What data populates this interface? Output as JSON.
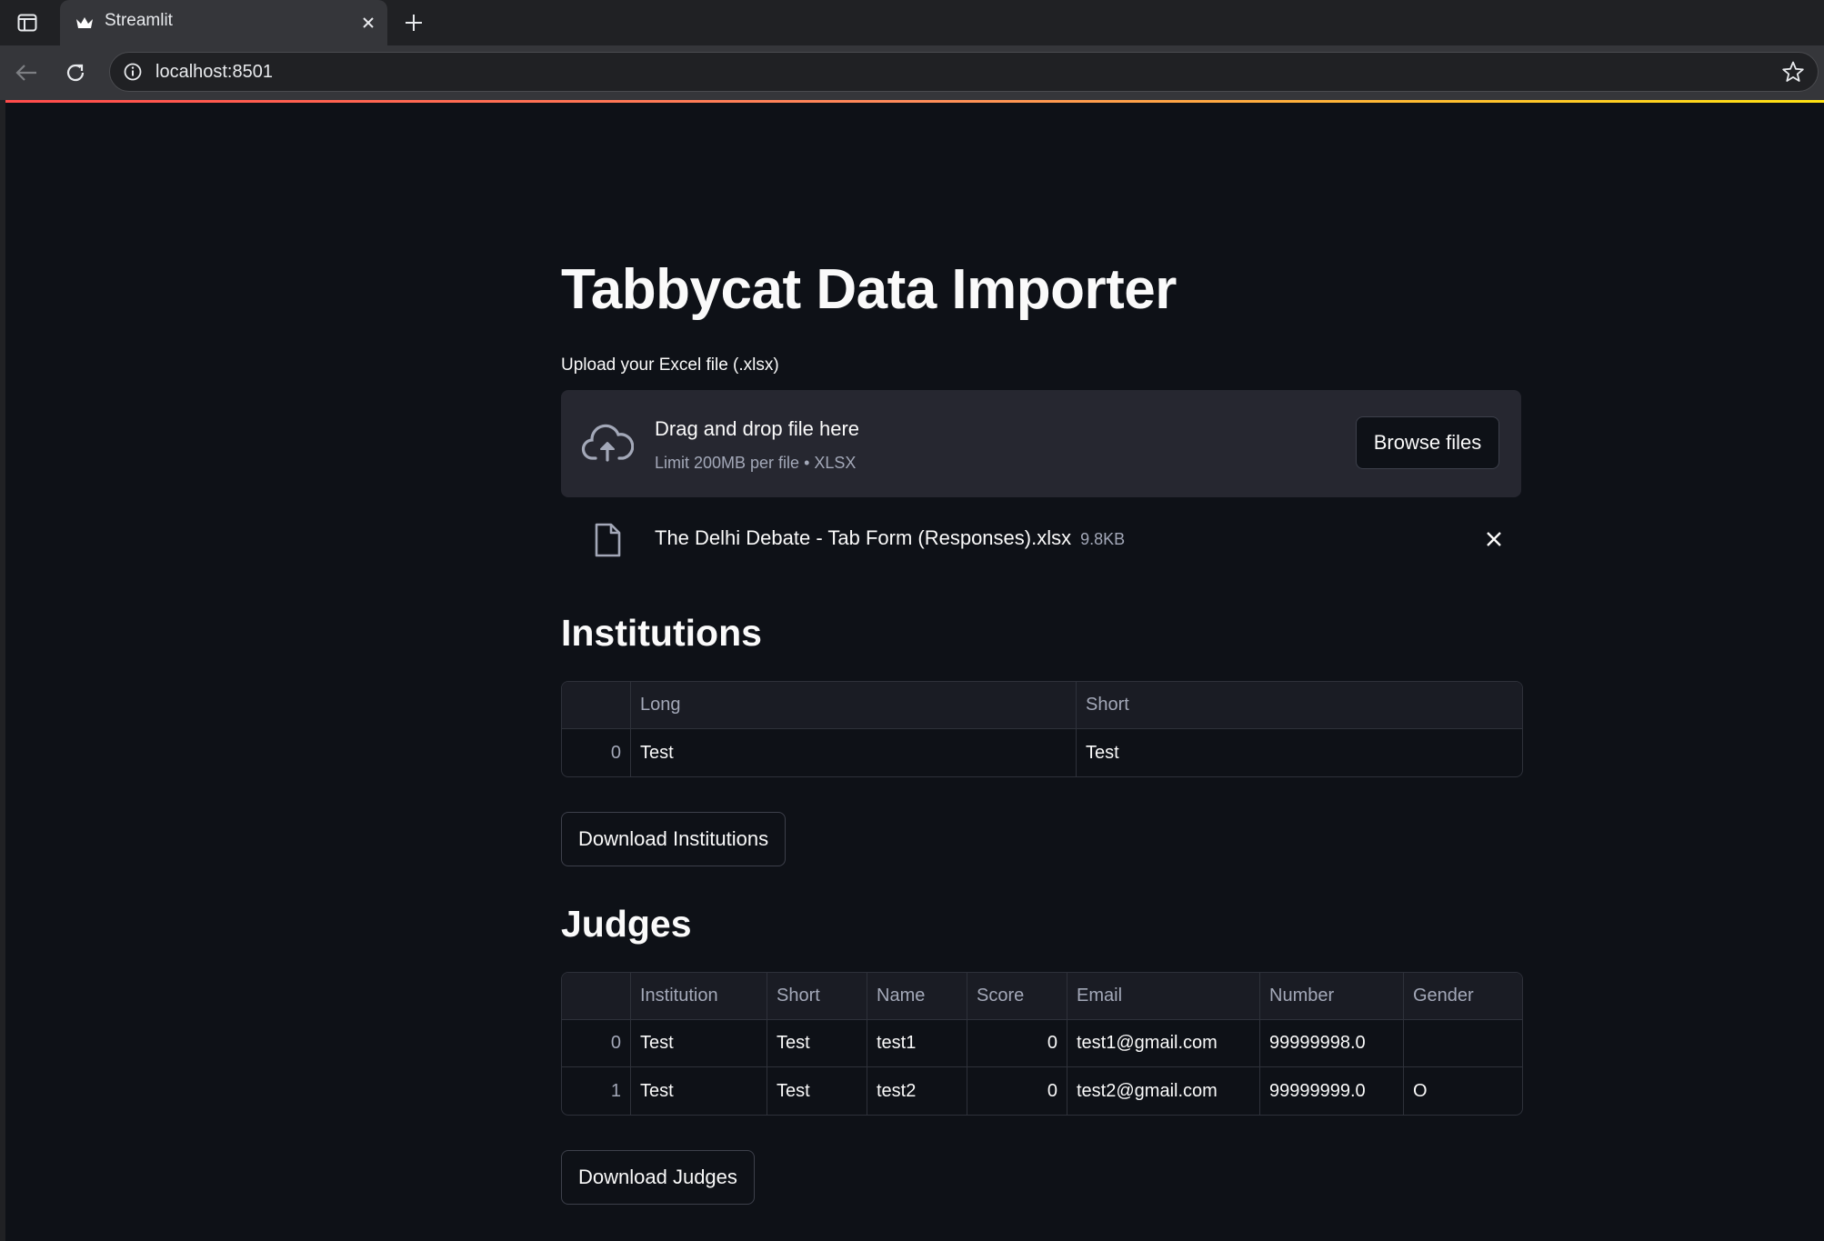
{
  "browser": {
    "tab_title": "Streamlit",
    "url": "localhost:8501"
  },
  "app": {
    "title": "Tabbycat Data Importer",
    "uploader": {
      "label": "Upload your Excel file (.xlsx)",
      "drop_text": "Drag and drop file here",
      "limit_text": "Limit 200MB per file • XLSX",
      "browse_label": "Browse files"
    },
    "uploaded_file": {
      "name": "The Delhi Debate - Tab Form (Responses).xlsx",
      "size": "9.8KB"
    },
    "institutions": {
      "heading": "Institutions",
      "columns": [
        "",
        "Long",
        "Short"
      ],
      "rows": [
        [
          "0",
          "Test",
          "Test"
        ]
      ],
      "download_label": "Download Institutions"
    },
    "judges": {
      "heading": "Judges",
      "columns": [
        "",
        "Institution",
        "Short",
        "Name",
        "Score",
        "Email",
        "Number",
        "Gender"
      ],
      "rows": [
        [
          "0",
          "Test",
          "Test",
          "test1",
          "0",
          "test1@gmail.com",
          "99999998.0",
          ""
        ],
        [
          "1",
          "Test",
          "Test",
          "test2",
          "0",
          "test2@gmail.com",
          "99999999.0",
          "O"
        ]
      ],
      "download_label": "Download Judges"
    }
  }
}
